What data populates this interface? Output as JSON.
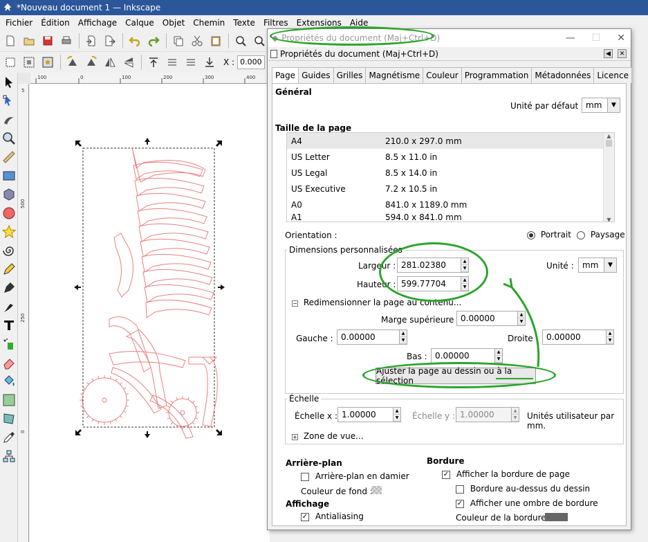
{
  "window": {
    "title": "*Nouveau document 1 — Inkscape"
  },
  "menu": [
    "Fichier",
    "Édition",
    "Affichage",
    "Calque",
    "Objet",
    "Chemin",
    "Texte",
    "Filtres",
    "Extensions",
    "Aide"
  ],
  "toolbar2": {
    "x_label": "X :",
    "x_value": "0.000"
  },
  "ruler": {
    "h_ticks": [
      "100",
      "0",
      "100",
      "200",
      "300",
      "400"
    ],
    "v_ticks": [
      "5",
      "500",
      "250",
      "0"
    ]
  },
  "dialog": {
    "title": "Propriétés du document (Maj+Ctrl+D)",
    "subtitle": "Propriétés du document (Maj+Ctrl+D)",
    "tabs": [
      "Page",
      "Guides",
      "Grilles",
      "Magnétisme",
      "Couleur",
      "Programmation",
      "Métadonnées",
      "Licence"
    ],
    "general": {
      "heading": "Général",
      "unit_label": "Unité par défaut :",
      "unit_value": "mm"
    },
    "page_size": {
      "heading": "Taille de la page",
      "rows": [
        {
          "name": "A4",
          "size": "210.0 x 297.0 mm"
        },
        {
          "name": "US Letter",
          "size": "8.5 x 11.0 in"
        },
        {
          "name": "US Legal",
          "size": "8.5 x 14.0 in"
        },
        {
          "name": "US Executive",
          "size": "7.2 x 10.5 in"
        },
        {
          "name": "A0",
          "size": "841.0 x 1189.0 mm"
        },
        {
          "name": "A1",
          "size": "594.0 x 841.0 mm"
        }
      ]
    },
    "orientation": {
      "label": "Orientation :",
      "portrait": "Portrait",
      "landscape": "Paysage"
    },
    "custom": {
      "heading": "Dimensions personnalisées",
      "width_label": "Largeur :",
      "width_value": "281.02380",
      "height_label": "Hauteur :",
      "height_value": "599.77704",
      "unit_label": "Unité :",
      "unit_value": "mm",
      "resize_label": "Redimensionner la page au contenu...",
      "margin_top_label": "Marge supérieure :",
      "margin_top_value": "0.00000",
      "left_label": "Gauche :",
      "left_value": "0.00000",
      "right_label": "Droite :",
      "right_value": "0.00000",
      "bottom_label": "Bas :",
      "bottom_value": "0.00000",
      "fit_button": "Ajuster la page au dessin ou à la sélection"
    },
    "scale": {
      "heading": "Échelle",
      "x_label": "Échelle x :",
      "x_value": "1.00000",
      "y_label": "Échelle y :",
      "y_value": "1.00000",
      "units_label": "Unités utilisateur par mm.",
      "viewbox_label": "Zone de vue..."
    },
    "background": {
      "heading": "Arrière-plan",
      "checker_label": "Arrière-plan en damier",
      "color_label": "Couleur de fond :"
    },
    "display": {
      "heading": "Affichage",
      "antialias_label": "Antialiasing"
    },
    "border": {
      "heading": "Bordure",
      "show_label": "Afficher la bordure de page",
      "ontop_label": "Bordure au-dessus du dessin",
      "shadow_label": "Afficher une ombre de bordure",
      "color_label": "Couleur de la bordure :"
    }
  },
  "colors": {
    "titlebar": "#2b579a",
    "annotation": "#2aa52a",
    "drawing_stroke": "#e88080",
    "border_color": "#666666"
  }
}
